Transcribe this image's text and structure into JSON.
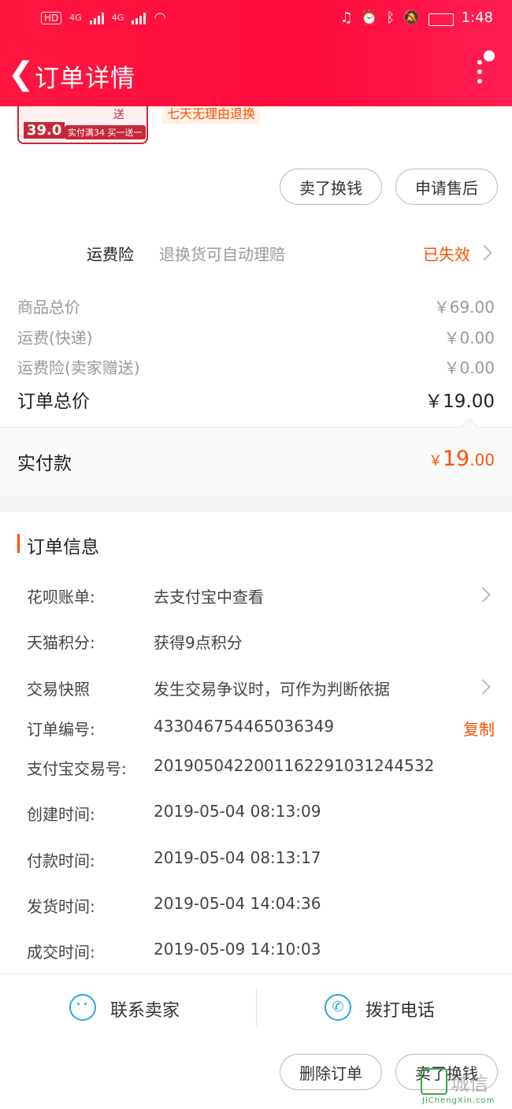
{
  "status_bar": {
    "left_label": "HD",
    "net1": "4G",
    "net2": "4G",
    "time": "1:48"
  },
  "header": {
    "title": "订单详情"
  },
  "product": {
    "tag": "七天无理由退换",
    "thumb_price": "39.0",
    "thumb_promo": "实付满34 买一送一",
    "thumb_mark": "送"
  },
  "item_actions": {
    "sell_label": "卖了换钱",
    "after_sale_label": "申请售后"
  },
  "insurance": {
    "label": "运费险",
    "desc": "退换货可自动理赔",
    "status": "已失效"
  },
  "pricing": {
    "goods_label": "商品总价",
    "goods_value": "￥69.00",
    "shipping_label": "运费(快递)",
    "shipping_value": "￥0.00",
    "ins_label": "运费险(卖家赠送)",
    "ins_value": "￥0.00",
    "total_label": "订单总价",
    "total_value": "￥19.00",
    "paid_label": "实付款",
    "paid_currency": "￥",
    "paid_int": "19",
    "paid_dec": ".00"
  },
  "order_info": {
    "title": "订单信息",
    "huabei_label": "花呗账单:",
    "huabei_value": "去支付宝中查看",
    "points_label": "天猫积分:",
    "points_value": "获得9点积分",
    "snapshot_label": "交易快照",
    "snapshot_value": "发生交易争议时，可作为判断依据",
    "order_no_label": "订单编号:",
    "order_no_value": "433046754465036349",
    "copy_label": "复制",
    "alipay_label": "支付宝交易号:",
    "alipay_value": "2019050422001162291031244532",
    "created_label": "创建时间:",
    "created_value": "2019-05-04 08:13:09",
    "paid_label": "付款时间:",
    "paid_value": "2019-05-04 08:13:17",
    "shipped_label": "发货时间:",
    "shipped_value": "2019-05-04 14:04:36",
    "done_label": "成交时间:",
    "done_value": "2019-05-09 14:10:03"
  },
  "contact": {
    "seller_label": "联系卖家",
    "call_label": "拨打电话"
  },
  "footer": {
    "delete_label": "删除订单",
    "sell_label": "卖了换钱"
  },
  "watermark": {
    "brand": "城信",
    "url": "JiChengXin.com"
  },
  "colors": {
    "header_red": "#ff0a3c",
    "accent_orange": "#ff5000",
    "icon_blue": "#2aa5e8"
  }
}
